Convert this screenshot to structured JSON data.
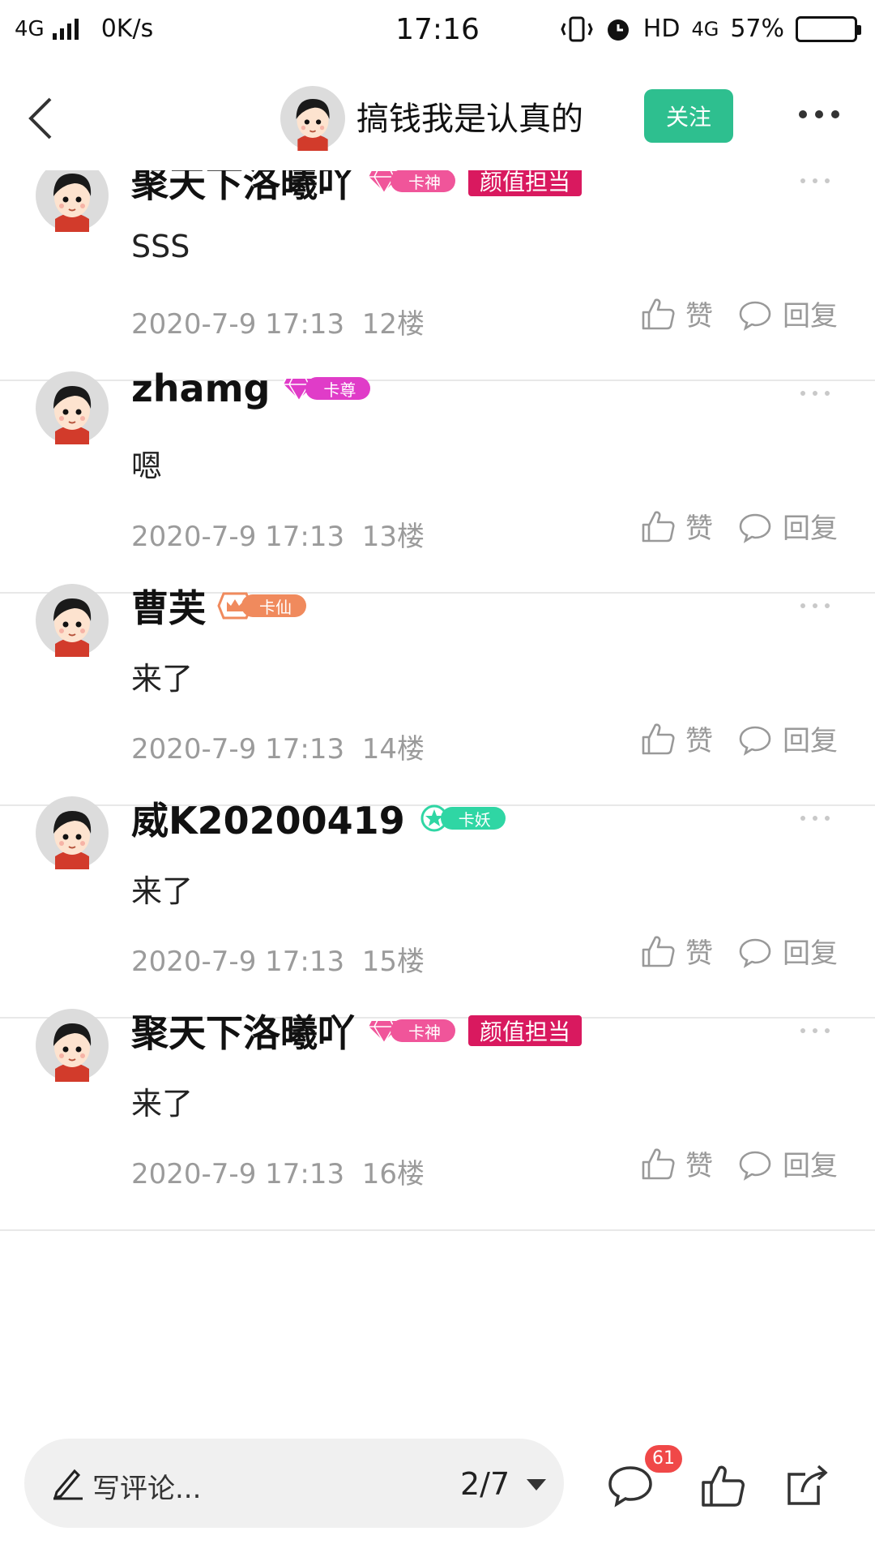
{
  "status_bar": {
    "network_label": "4G",
    "speed": "0K/s",
    "time": "17:16",
    "hd_label": "HD",
    "data_label": "4G",
    "battery": "57%",
    "battery_level": 0.57
  },
  "header": {
    "title": "搞钱我是认真的",
    "follow_label": "关注"
  },
  "comments": [
    {
      "username": "聚天下洛曦吖",
      "badge_text": "卡神",
      "badge_kind": "diamond-pink",
      "extra_tag": "颜值担当",
      "text": "SSS",
      "datetime": "2020-7-9 17:13",
      "floor": "12楼",
      "like_label": "赞",
      "reply_label": "回复"
    },
    {
      "username": "zhamg",
      "badge_text": "卡尊",
      "badge_kind": "diamond-magenta",
      "extra_tag": "",
      "text": "嗯",
      "datetime": "2020-7-9 17:13",
      "floor": "13楼",
      "like_label": "赞",
      "reply_label": "回复"
    },
    {
      "username": "曹芙",
      "badge_text": "卡仙",
      "badge_kind": "crown-orange",
      "extra_tag": "",
      "text": "来了",
      "datetime": "2020-7-9 17:13",
      "floor": "14楼",
      "like_label": "赞",
      "reply_label": "回复"
    },
    {
      "username": "威K20200419",
      "badge_text": "卡妖",
      "badge_kind": "star-green",
      "extra_tag": "",
      "text": "来了",
      "datetime": "2020-7-9 17:13",
      "floor": "15楼",
      "like_label": "赞",
      "reply_label": "回复"
    },
    {
      "username": "聚天下洛曦吖",
      "badge_text": "卡神",
      "badge_kind": "diamond-pink",
      "extra_tag": "颜值担当",
      "text": "来了",
      "datetime": "2020-7-9 17:13",
      "floor": "16楼",
      "like_label": "赞",
      "reply_label": "回复"
    }
  ],
  "bottom_bar": {
    "comment_placeholder": "写评论...",
    "page_indicator": "2/7",
    "comment_count": "61"
  },
  "colors": {
    "accent_green": "#2ebf8f",
    "tag_red": "#d9195f",
    "badge_red": "#f04848"
  }
}
